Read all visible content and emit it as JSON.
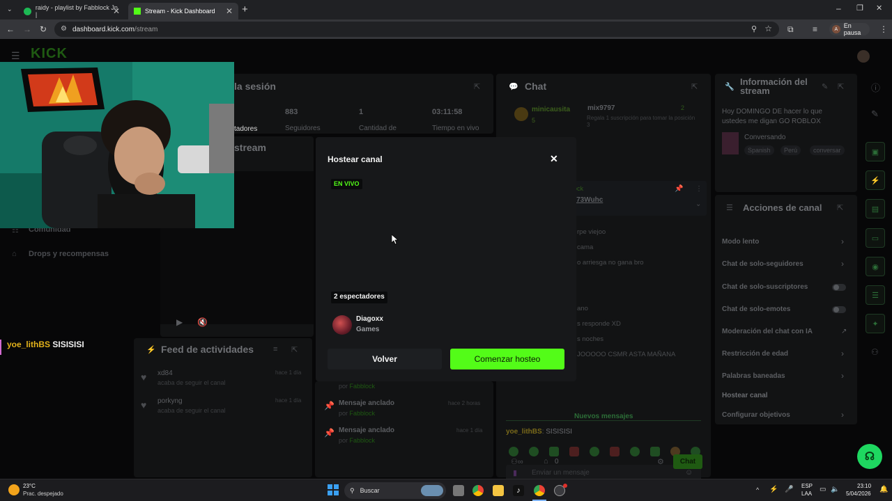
{
  "browser": {
    "tabs": [
      {
        "label": "raidy - playlist by Fabblock Jn |"
      },
      {
        "label": "Stream - Kick Dashboard"
      }
    ],
    "url_host": "dashboard.kick.com",
    "url_path": "/stream",
    "profile_label": "En pausa",
    "profile_initial": "A"
  },
  "dashboard": {
    "brand": "KICK",
    "session": {
      "title": "la sesión",
      "stats": [
        {
          "value": "883",
          "label": "Seguidores"
        },
        {
          "value": "1",
          "label": "Cantidad de"
        },
        {
          "value": "03:11:58",
          "label": "Tiempo en vivo"
        }
      ],
      "stats_prefix_label": "tadores"
    },
    "stream_title": "stream",
    "left_nav": [
      {
        "label": "Comunidad"
      },
      {
        "label": "Drops y recompensas"
      }
    ],
    "overlay_chat_user": "yoe_lithBS",
    "overlay_chat_text": "SISISISI",
    "feed": {
      "title": "Feed de actividades",
      "items": [
        {
          "user": "xd84",
          "sub": "acaba de seguir el canal",
          "time": "hace 1 día"
        },
        {
          "user": "porkyng",
          "sub": "acaba de seguir el canal",
          "time": "hace 1 día"
        }
      ]
    },
    "pins": [
      {
        "title": "Mensaje anclado",
        "sub": "por",
        "by": "Fabblock",
        "time": ""
      },
      {
        "title": "Mensaje anclado",
        "sub": "por",
        "by": "Fabblock",
        "time": "hace 2 horas"
      },
      {
        "title": "Mensaje anclado",
        "sub": "por",
        "by": "Fabblock",
        "time": "hace 1 día"
      }
    ],
    "chat": {
      "title": "Chat",
      "top_gifter": "minicausita",
      "top_gifter_count": "5",
      "gift_user": "mix9797",
      "gift_count": "2",
      "gift_text": "Regala 1 suscripción para tomar la posición 3",
      "pinned_user": "Z73Wuhc",
      "pinned_label": "lock",
      "lines": [
        "rpe viejoo",
        "cama",
        "o arriesga no gana bro",
        "ano",
        "s responde XD",
        "s noches",
        "JOOOOO CSMR ASTA MAÑANA"
      ],
      "new_messages": "Nuevos mensajes",
      "last_user": "yoe_lithBS",
      "last_text": "SISISISI",
      "input_placeholder": "Enviar un mensaje",
      "count": "0",
      "send_label": "Chat"
    },
    "stream_info": {
      "title": "Información del stream",
      "text": "Hoy DOMINGO DE hacer lo que ustedes me digan GO ROBLOX",
      "category": "Conversando",
      "tags": [
        "Spanish",
        "Perú",
        "conversar"
      ]
    },
    "channel_actions": {
      "title": "Acciones de canal",
      "items": [
        {
          "label": "Modo lento",
          "control": "chevron"
        },
        {
          "label": "Chat de solo-seguidores",
          "control": "chevron"
        },
        {
          "label": "Chat de solo-suscriptores",
          "control": "toggle"
        },
        {
          "label": "Chat de solo-emotes",
          "control": "toggle"
        },
        {
          "label": "Moderación del chat con IA",
          "control": "external"
        },
        {
          "label": "Restricción de edad",
          "control": "chevron"
        },
        {
          "label": "Palabras baneadas",
          "control": "chevron"
        },
        {
          "label": "Hostear canal",
          "control": "none"
        },
        {
          "label": "Configurar objetivos",
          "control": "chevron"
        }
      ]
    }
  },
  "modal": {
    "title": "Hostear canal",
    "live_badge": "EN VIVO",
    "viewers": "2 espectadores",
    "channel_name": "Diagoxx",
    "channel_category": "Games",
    "back_label": "Volver",
    "start_label": "Comenzar hosteo",
    "accent": "#53fc18"
  },
  "taskbar": {
    "weather_temp": "23°C",
    "weather_desc": "Prac. despejado",
    "search_label": "Buscar",
    "lang_top": "ESP",
    "lang_bottom": "LAA",
    "time": "23:10",
    "date": "5/04/2026"
  }
}
